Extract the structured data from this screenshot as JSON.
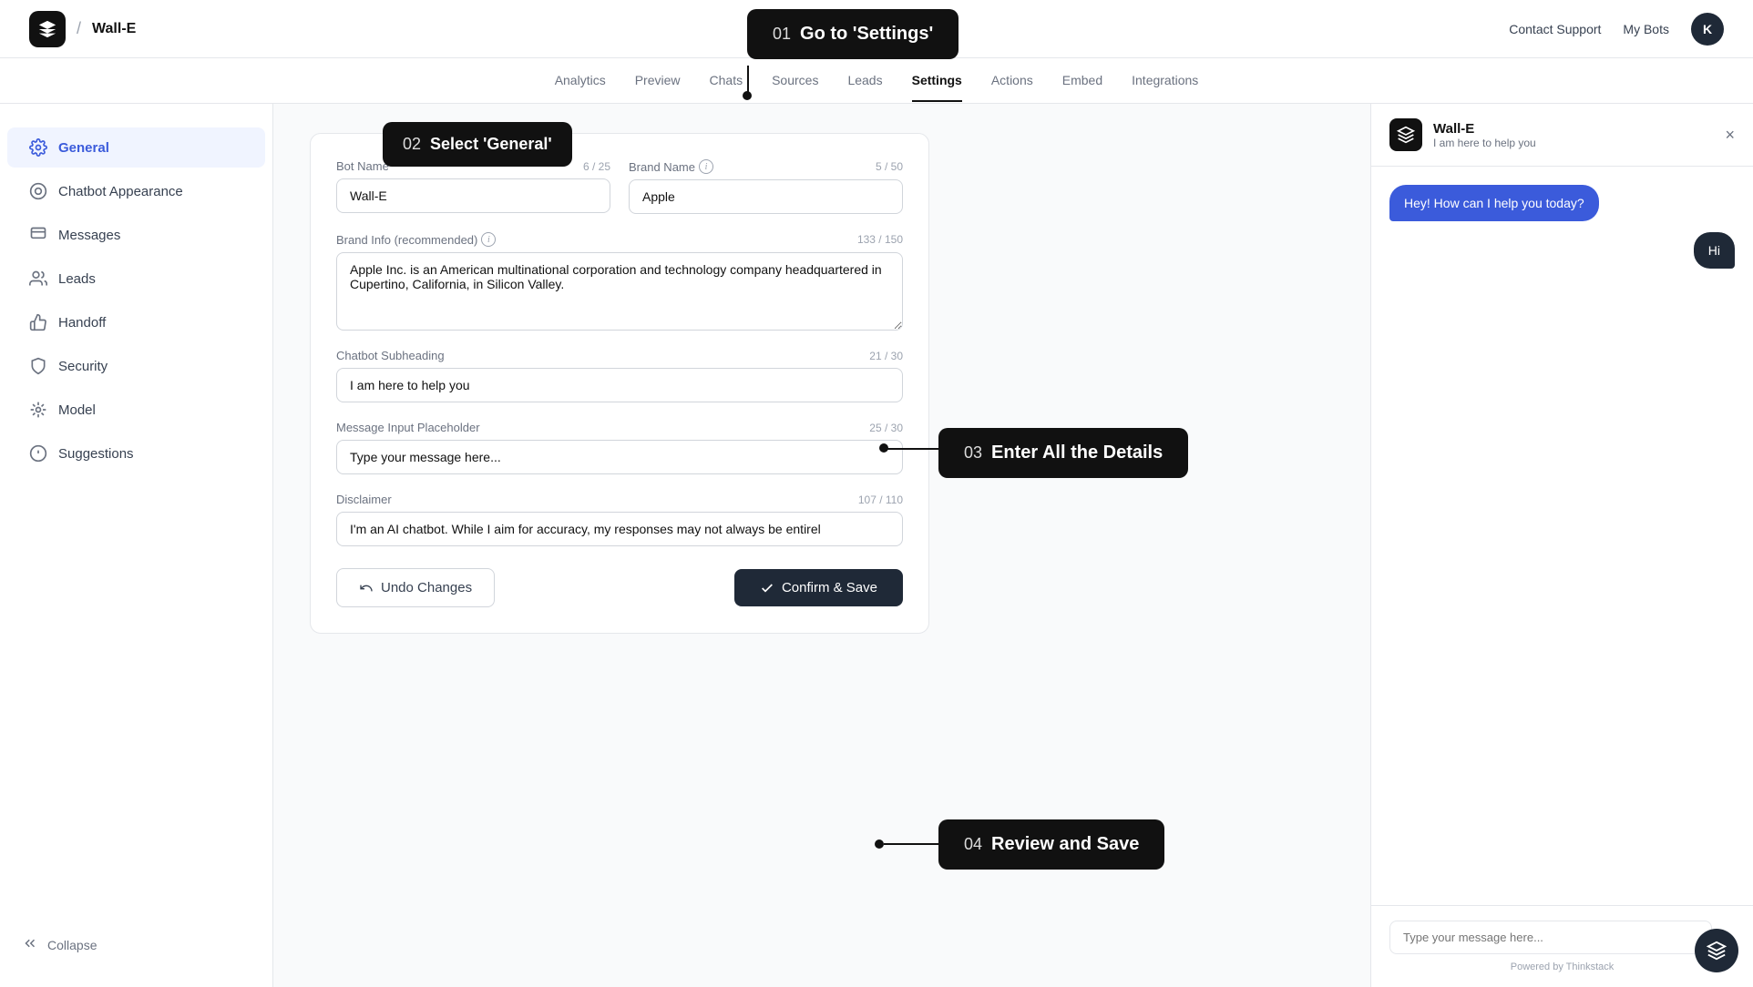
{
  "topbar": {
    "logo_alt": "Wall-E logo",
    "breadcrumb_sep": "/",
    "title": "Wall-E",
    "contact_support": "Contact Support",
    "my_bots": "My Bots",
    "avatar_letter": "K"
  },
  "nav": {
    "tabs": [
      {
        "label": "Analytics",
        "active": false
      },
      {
        "label": "Preview",
        "active": false
      },
      {
        "label": "Chats",
        "active": false
      },
      {
        "label": "Sources",
        "active": false
      },
      {
        "label": "Leads",
        "active": false
      },
      {
        "label": "Settings",
        "active": true
      },
      {
        "label": "Actions",
        "active": false
      },
      {
        "label": "Embed",
        "active": false
      },
      {
        "label": "Integrations",
        "active": false
      }
    ]
  },
  "sidebar": {
    "items": [
      {
        "label": "General",
        "active": true,
        "icon": "gear"
      },
      {
        "label": "Chatbot Appearance",
        "active": false,
        "icon": "appearance"
      },
      {
        "label": "Messages",
        "active": false,
        "icon": "messages"
      },
      {
        "label": "Leads",
        "active": false,
        "icon": "leads"
      },
      {
        "label": "Handoff",
        "active": false,
        "icon": "handoff"
      },
      {
        "label": "Security",
        "active": false,
        "icon": "security"
      },
      {
        "label": "Model",
        "active": false,
        "icon": "model"
      },
      {
        "label": "Suggestions",
        "active": false,
        "icon": "suggestions"
      }
    ],
    "collapse": "Collapse"
  },
  "form": {
    "bot_name_label": "Bot Name",
    "bot_name_count": "6 / 25",
    "bot_name_value": "Wall-E",
    "brand_name_label": "Brand Name",
    "brand_name_count": "5 / 50",
    "brand_name_value": "Apple",
    "brand_info_label": "Brand Info (recommended)",
    "brand_info_count": "133 / 150",
    "brand_info_value": "Apple Inc. is an American multinational corporation and technology company headquartered in Cupertino, California, in Silicon Valley.",
    "subheading_label": "Chatbot Subheading",
    "subheading_count": "21 / 30",
    "subheading_value": "I am here to help you",
    "placeholder_label": "Message Input Placeholder",
    "placeholder_count": "25 / 30",
    "placeholder_value": "Type your message here...",
    "disclaimer_label": "Disclaimer",
    "disclaimer_count": "107 / 110",
    "disclaimer_value": "I'm an AI chatbot. While I aim for accuracy, my responses may not always be entirel"
  },
  "buttons": {
    "undo_label": "Undo Changes",
    "save_label": "Confirm & Save"
  },
  "chat": {
    "bot_name": "Wall-E",
    "bot_subheading": "I am here to help you",
    "close_btn": "×",
    "bot_message": "Hey! How can I help you today?",
    "user_message": "Hi",
    "input_placeholder": "Type your message here...",
    "powered_by": "Powered by Thinkstack",
    "send_icon": "➤"
  },
  "callouts": {
    "c1_num": "01",
    "c1_text": "Go to 'Settings'",
    "c2_num": "02",
    "c2_text": "Select 'General'",
    "c3_num": "03",
    "c3_text": "Enter All the Details",
    "c4_num": "04",
    "c4_text": "Review and Save"
  }
}
